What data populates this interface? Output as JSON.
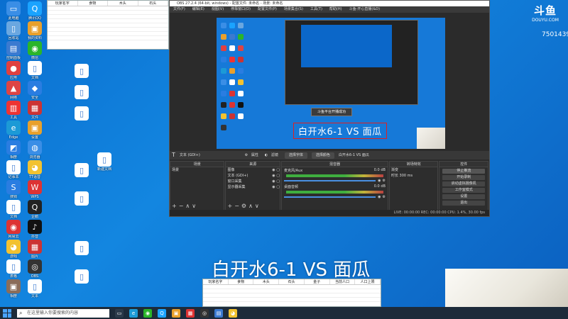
{
  "desktop_icons": [
    {
      "label": "此电脑",
      "color": "#3a8ee6",
      "glyph": "▭"
    },
    {
      "label": "腾讯QQ",
      "color": "#1aa3ff",
      "glyph": "Q"
    },
    {
      "label": "回收站",
      "color": "#6aa7e0",
      "glyph": "▯"
    },
    {
      "label": "我的资料",
      "color": "#e8a02c",
      "glyph": "▣"
    },
    {
      "label": "控制面板",
      "color": "#3b7ad0",
      "glyph": "▤"
    },
    {
      "label": "微信",
      "color": "#2ab52a",
      "glyph": "◉"
    },
    {
      "label": "应用",
      "color": "#e04040",
      "glyph": "●"
    },
    {
      "label": "文档",
      "color": "#ffffff",
      "glyph": "▯"
    },
    {
      "label": "网络",
      "color": "#d44",
      "glyph": "▲"
    },
    {
      "label": "安全",
      "color": "#2a7de1",
      "glyph": "◆"
    },
    {
      "label": "工具",
      "color": "#e33",
      "glyph": "▥"
    },
    {
      "label": "文件",
      "color": "#c33",
      "glyph": "▦"
    },
    {
      "label": "Edge",
      "color": "#1c9ad6",
      "glyph": "e"
    },
    {
      "label": "设置",
      "color": "#e8a02c",
      "glyph": "▣"
    },
    {
      "label": "相册",
      "color": "#2a7de1",
      "glyph": "◩"
    },
    {
      "label": "浏览器",
      "color": "#3a8ee6",
      "glyph": "◍"
    },
    {
      "label": "记事本",
      "color": "#ffffff",
      "glyph": "▯"
    },
    {
      "label": "TT语音",
      "color": "#f2c230",
      "glyph": "◕"
    },
    {
      "label": "搜狗",
      "color": "#2a7de1",
      "glyph": "S"
    },
    {
      "label": "WPS",
      "color": "#d33",
      "glyph": "W"
    },
    {
      "label": "文档",
      "color": "#ffffff",
      "glyph": "▯"
    },
    {
      "label": "企鹅",
      "color": "#222",
      "glyph": "Q"
    },
    {
      "label": "网易云",
      "color": "#d33",
      "glyph": "◉"
    },
    {
      "label": "抖音",
      "color": "#111",
      "glyph": "♪"
    },
    {
      "label": "游戏",
      "color": "#f2c230",
      "glyph": "◕"
    },
    {
      "label": "图片",
      "color": "#c33",
      "glyph": "▦"
    },
    {
      "label": "表格",
      "color": "#ffffff",
      "glyph": "▯"
    },
    {
      "label": "OBS",
      "color": "#333",
      "glyph": "◎"
    },
    {
      "label": "相册",
      "color": "#8a6d5a",
      "glyph": "▣"
    },
    {
      "label": "文本",
      "color": "#ffffff",
      "glyph": "▯"
    }
  ],
  "desktop_file": {
    "label": "新建文档",
    "color": "#ffffff"
  },
  "sheet": {
    "headers": [
      "玩家名字",
      "食物",
      "木头",
      "石头"
    ]
  },
  "obs": {
    "title": "OBS 27.2.4 (64-bit, windows) - 配置文件: 未命名 - 场景: 未命名",
    "menu": [
      "文件(F)",
      "编辑(E)",
      "视图(V)",
      "停靠窗口(D)",
      "配置文件(P)",
      "场景集合(S)",
      "工具(T)",
      "帮助(H)",
      "斗鱼-开心直播(&D)"
    ],
    "toast": "斗鱼平台开播成功",
    "overlay_text": "白开水6-1 VS 面瓜",
    "source_bar": {
      "name": "文本 (GDI+)",
      "props": "属性",
      "filters": "滤镜",
      "select_file": "选择字体",
      "select_color": "选择颜色",
      "text_value": "白开水6-1 VS 面瓜"
    },
    "docks": {
      "scenes": {
        "title": "场景",
        "items": [
          "场景"
        ]
      },
      "sources": {
        "title": "来源",
        "items": [
          "图像",
          "文本 (GDI+)",
          "窗口采集",
          "显示器采集"
        ]
      },
      "mixer": {
        "title": "混音器",
        "tracks": [
          {
            "name": "麦克风/Aux",
            "db": "0.0 dB"
          },
          {
            "name": "桌面音频",
            "db": "0.0 dB"
          }
        ]
      },
      "transitions": {
        "title": "转场特效",
        "type": "渐变",
        "duration_label": "时长",
        "duration": "300 ms"
      },
      "controls": {
        "title": "控件",
        "buttons": [
          "停止推流",
          "开始录制",
          "启动虚拟摄像机",
          "工作室模式",
          "设置",
          "退出"
        ]
      }
    },
    "status": "LIVE: 00:00:00   REC: 00:00:00   CPU: 1.4%, 30.00 fps"
  },
  "big_overlay_text": "白开水6-1 VS 面瓜",
  "sheet2": {
    "headers": [
      "玩家名字",
      "食物",
      "木头",
      "石头",
      "金子",
      "当前人口",
      "人口上限"
    ]
  },
  "watermark": {
    "logo": "斗鱼",
    "sub": "DOUYU.COM",
    "room": "7501439"
  },
  "taskbar": {
    "search_placeholder": "在这里输入你要搜索的内容",
    "icons": [
      {
        "name": "task-view-icon",
        "color": "#2b3a4a",
        "glyph": "▭"
      },
      {
        "name": "edge-icon",
        "color": "#1c9ad6",
        "glyph": "e"
      },
      {
        "name": "wechat-icon",
        "color": "#2ab52a",
        "glyph": "◉"
      },
      {
        "name": "qq-icon",
        "color": "#1aa3ff",
        "glyph": "Q"
      },
      {
        "name": "files-icon",
        "color": "#e8a02c",
        "glyph": "▣"
      },
      {
        "name": "app-icon",
        "color": "#d33",
        "glyph": "▦"
      },
      {
        "name": "obs-icon",
        "color": "#333",
        "glyph": "◎"
      },
      {
        "name": "store-icon",
        "color": "#3b7ad0",
        "glyph": "▤"
      },
      {
        "name": "game-icon",
        "color": "#f2c230",
        "glyph": "◕"
      }
    ]
  }
}
